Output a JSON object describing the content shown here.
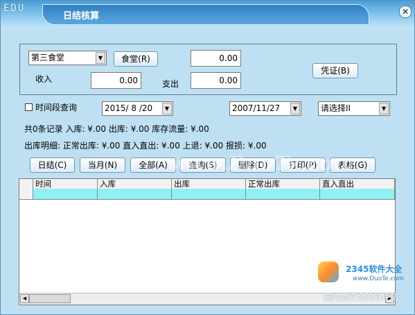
{
  "window": {
    "logo": "EDU",
    "title": "日结核算",
    "close": "✕"
  },
  "filters": {
    "canteen": "第三食堂",
    "canteen_btn": "食堂(R)",
    "income_label": "收入",
    "income_value": "0.00",
    "expense_label": "支出",
    "field_top_value": "0.00",
    "expense_value": "0.00",
    "voucher_btn": "凭证(B)"
  },
  "period": {
    "checkbox_label": "时间段查询",
    "date_from": "2015/ 8 /20",
    "date_to": "2007/11/27",
    "select": "请选择II"
  },
  "summary": {
    "line1": "共0条记录 入库: ¥.00 出库: ¥.00 库存流量: ¥.00",
    "line2": "出库明细: 正常出库: ¥.00 直入直出: ¥.00 上退: ¥.00 报损: ¥.00"
  },
  "buttons": {
    "daily": "日结(C)",
    "month": "当月(N)",
    "all": "全部(A)",
    "query": "查询(S)",
    "delete": "删除(D)",
    "print": "打印(P)",
    "table": "表格(G)"
  },
  "table": {
    "columns": [
      "时间",
      "入库",
      "出库",
      "正常出库",
      "直入直出"
    ]
  },
  "watermarks": {
    "center": "www.DuoTe.com",
    "brand": "2345软件大全",
    "brand_url": "www.DuoTe.com",
    "footer": "国内最安全的软件站"
  }
}
